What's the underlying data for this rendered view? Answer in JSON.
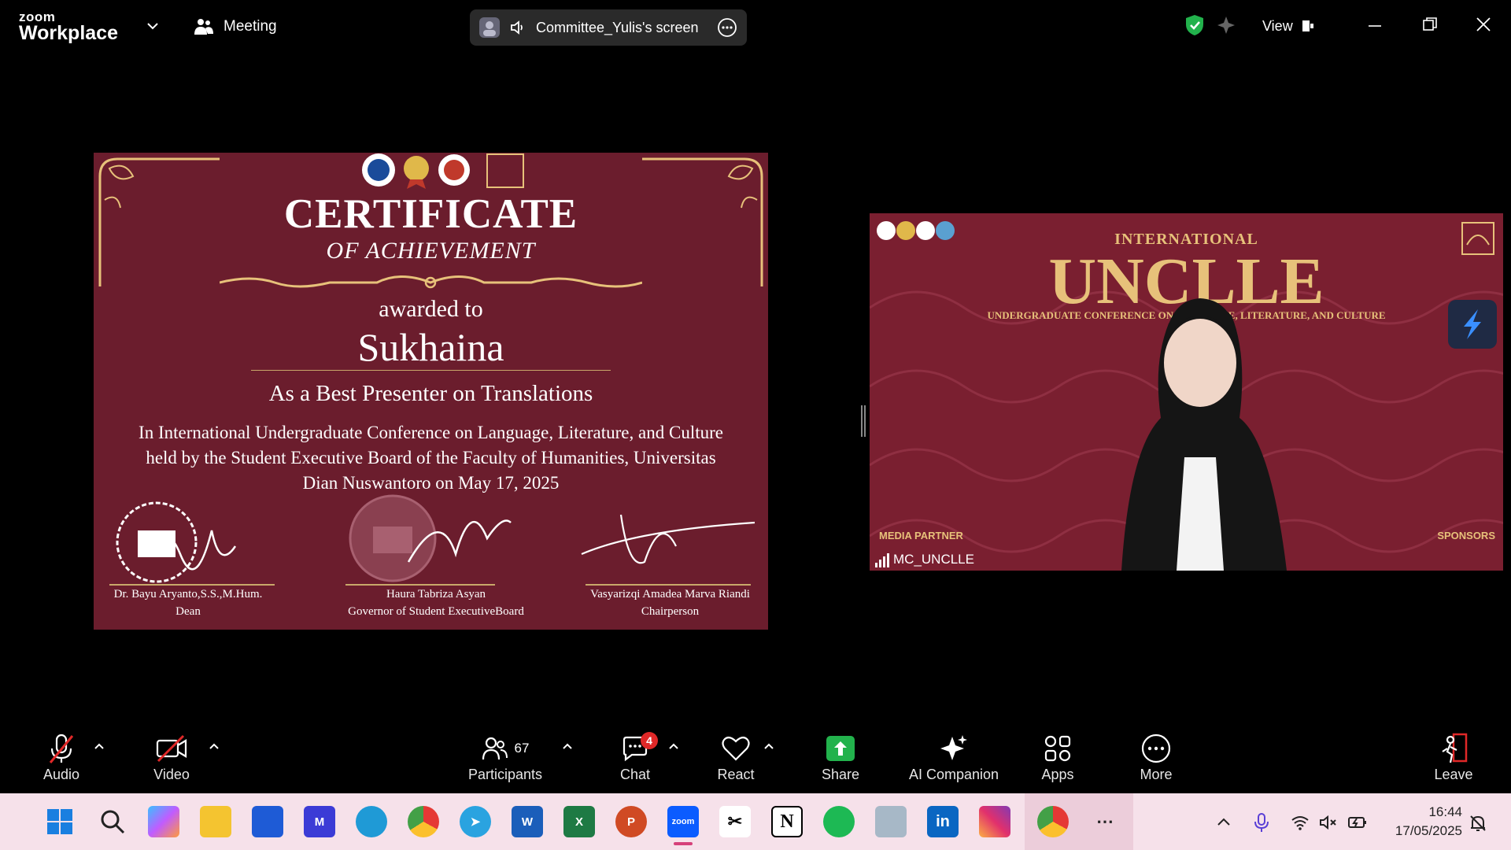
{
  "topbar": {
    "logo_small": "zoom",
    "logo_big": "Workplace",
    "meeting_label": "Meeting",
    "screen_label": "Committee_Yulis's screen",
    "view_label": "View"
  },
  "certificate": {
    "title": "CERTIFICATE",
    "subtitle": "OF ACHIEVEMENT",
    "awarded": "awarded to",
    "recipient": "Sukhaina",
    "award": "As a Best Presenter on Translations",
    "body": "In International Undergraduate Conference on Language, Literature, and Culture held by the Student Executive Board of the Faculty of Humanities, Universitas Dian Nuswantoro on May 17, 2025",
    "signers": [
      {
        "name": "Dr. Bayu Aryanto,S.S.,M.Hum.",
        "role": "Dean"
      },
      {
        "name": "Haura Tabriza Asyan",
        "role": "Governor of Student ExecutiveBoard"
      },
      {
        "name": "Vasyarizqi Amadea Marva Riandi",
        "role": "Chairperson"
      }
    ]
  },
  "video": {
    "title_small": "INTERNATIONAL",
    "title_big": "UNCLLE",
    "subtitle": "UNDERGRADUATE CONFERENCE ON LANGUAGE, LITERATURE, AND CULTURE",
    "media_partner": "MEDIA PARTNER",
    "sponsors": "SPONSORS",
    "participant_name": "MC_UNCLLE"
  },
  "toolbar": {
    "audio": "Audio",
    "video": "Video",
    "participants": "Participants",
    "participants_count": "67",
    "chat": "Chat",
    "chat_badge": "4",
    "react": "React",
    "share": "Share",
    "ai": "AI Companion",
    "apps": "Apps",
    "more": "More",
    "leave": "Leave"
  },
  "taskbar": {
    "time": "16:44",
    "date": "17/05/2025",
    "zoom_label": "zoom"
  },
  "colors": {
    "share_green": "#22b24c",
    "badge_red": "#e02828",
    "cert_bg": "#6b1d2d",
    "gold": "#e7c17a"
  }
}
